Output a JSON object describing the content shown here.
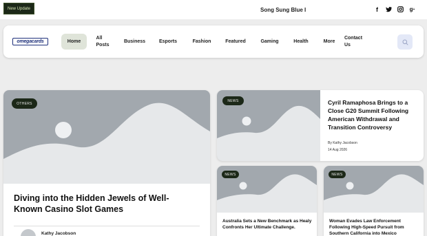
{
  "topbar": {
    "update_label": "New Update",
    "ticker_text": "Song Sung Blue I",
    "socials": [
      "f",
      "t",
      "ig",
      "g+"
    ]
  },
  "header": {
    "logo_text": "omegacards",
    "nav": [
      "Home",
      "All\nPosts",
      "Business",
      "Esports",
      "Fashion",
      "Featured",
      "Gaming",
      "Health",
      "More",
      "Contact\nUs"
    ],
    "active_nav": "Home"
  },
  "colors": {
    "tag_bg": "#1c2818",
    "placeholder": "#a2a8ae",
    "nav_active_bg": "#dfe4d9",
    "search_bg": "#e3e8f7"
  },
  "featured": {
    "tag": "OTHERS",
    "title": "Diving into the Hidden Jewels of Well-Known Casino Slot Games",
    "author": "Kathy Jacobson"
  },
  "right_top": {
    "tag": "NEWS",
    "title": "Cyril Ramaphosa Brings to a Close G20 Summit Following American Withdrawal and Transition Controversy",
    "author": "By Kathy Jacobson",
    "date": "14 Aug 2026"
  },
  "small_cards": [
    {
      "tag": "NEWS",
      "title": "Australia Sets a New Benchmark as Healy Confronts Her Ultimate Challenge."
    },
    {
      "tag": "NEWS",
      "title": "Woman Evades Law Enforcement Following High-Speed Pursuit from Southern California into Mexico"
    }
  ]
}
